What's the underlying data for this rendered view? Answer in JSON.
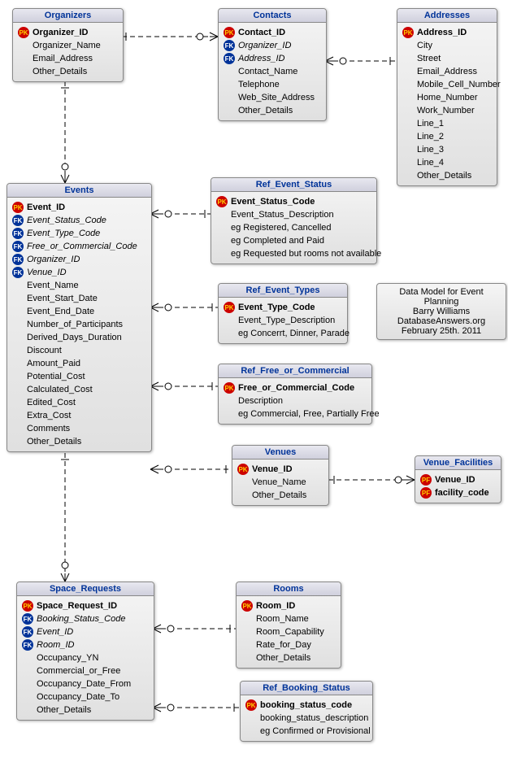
{
  "info": {
    "line1": "Data Model for Event Planning",
    "line2": "Barry Williams",
    "line3": "DatabaseAnswers.org",
    "line4": "February 25th.  2011"
  },
  "entities": {
    "organizers": {
      "title": "Organizers",
      "rows": [
        {
          "key": "PK",
          "label": "Organizer_ID",
          "b": true
        },
        {
          "key": "",
          "label": "Organizer_Name"
        },
        {
          "key": "",
          "label": "Email_Address"
        },
        {
          "key": "",
          "label": "Other_Details"
        }
      ]
    },
    "contacts": {
      "title": "Contacts",
      "rows": [
        {
          "key": "PK",
          "label": "Contact_ID",
          "b": true
        },
        {
          "key": "FK",
          "label": "Organizer_ID",
          "i": true
        },
        {
          "key": "FK",
          "label": "Address_ID",
          "i": true
        },
        {
          "key": "",
          "label": "Contact_Name"
        },
        {
          "key": "",
          "label": "Telephone"
        },
        {
          "key": "",
          "label": "Web_Site_Address"
        },
        {
          "key": "",
          "label": "Other_Details"
        }
      ]
    },
    "addresses": {
      "title": "Addresses",
      "rows": [
        {
          "key": "PK",
          "label": "Address_ID",
          "b": true
        },
        {
          "key": "",
          "label": "City"
        },
        {
          "key": "",
          "label": "Street"
        },
        {
          "key": "",
          "label": "Email_Address"
        },
        {
          "key": "",
          "label": "Mobile_Cell_Number"
        },
        {
          "key": "",
          "label": "Home_Number"
        },
        {
          "key": "",
          "label": "Work_Number"
        },
        {
          "key": "",
          "label": "Line_1"
        },
        {
          "key": "",
          "label": "Line_2"
        },
        {
          "key": "",
          "label": "Line_3"
        },
        {
          "key": "",
          "label": "Line_4"
        },
        {
          "key": "",
          "label": "Other_Details"
        }
      ]
    },
    "events": {
      "title": "Events",
      "rows": [
        {
          "key": "PK",
          "label": "Event_ID",
          "b": true
        },
        {
          "key": "FK",
          "label": "Event_Status_Code",
          "i": true
        },
        {
          "key": "FK",
          "label": "Event_Type_Code",
          "i": true
        },
        {
          "key": "FK",
          "label": "Free_or_Commercial_Code",
          "i": true
        },
        {
          "key": "FK",
          "label": "Organizer_ID",
          "i": true
        },
        {
          "key": "FK",
          "label": "Venue_ID",
          "i": true
        },
        {
          "key": "",
          "label": "Event_Name"
        },
        {
          "key": "",
          "label": "Event_Start_Date"
        },
        {
          "key": "",
          "label": "Event_End_Date"
        },
        {
          "key": "",
          "label": "Number_of_Participants"
        },
        {
          "key": "",
          "label": "Derived_Days_Duration"
        },
        {
          "key": "",
          "label": "Discount"
        },
        {
          "key": "",
          "label": "Amount_Paid"
        },
        {
          "key": "",
          "label": "Potential_Cost"
        },
        {
          "key": "",
          "label": "Calculated_Cost"
        },
        {
          "key": "",
          "label": "Edited_Cost"
        },
        {
          "key": "",
          "label": "Extra_Cost"
        },
        {
          "key": "",
          "label": "Comments"
        },
        {
          "key": "",
          "label": "Other_Details"
        }
      ]
    },
    "ref_event_status": {
      "title": "Ref_Event_Status",
      "rows": [
        {
          "key": "PK",
          "label": "Event_Status_Code",
          "b": true
        },
        {
          "key": "",
          "label": "Event_Status_Description"
        },
        {
          "key": "",
          "label": "eg Registered, Cancelled"
        },
        {
          "key": "",
          "label": "eg Completed and Paid"
        },
        {
          "key": "",
          "label": "eg Requested but rooms not available"
        }
      ]
    },
    "ref_event_types": {
      "title": "Ref_Event_Types",
      "rows": [
        {
          "key": "PK",
          "label": "Event_Type_Code",
          "b": true
        },
        {
          "key": "",
          "label": "Event_Type_Description"
        },
        {
          "key": "",
          "label": "eg Concerrt, Dinner, Parade"
        }
      ]
    },
    "ref_free_or_commercial": {
      "title": "Ref_Free_or_Commercial",
      "rows": [
        {
          "key": "PK",
          "label": "Free_or_Commercial_Code",
          "b": true
        },
        {
          "key": "",
          "label": "Description"
        },
        {
          "key": "",
          "label": "eg Commercial, Free, Partially Free"
        }
      ]
    },
    "venues": {
      "title": "Venues",
      "rows": [
        {
          "key": "PK",
          "label": "Venue_ID",
          "b": true
        },
        {
          "key": "",
          "label": "Venue_Name"
        },
        {
          "key": "",
          "label": "Other_Details"
        }
      ]
    },
    "venue_facilities": {
      "title": "Venue_Facilities",
      "rows": [
        {
          "key": "PF",
          "label": "Venue_ID",
          "b": true
        },
        {
          "key": "PF",
          "label": "facility_code",
          "b": true
        }
      ]
    },
    "space_requests": {
      "title": "Space_Requests",
      "rows": [
        {
          "key": "PK",
          "label": "Space_Request_ID",
          "b": true
        },
        {
          "key": "FK",
          "label": "Booking_Status_Code",
          "i": true
        },
        {
          "key": "FK",
          "label": "Event_ID",
          "i": true
        },
        {
          "key": "FK",
          "label": "Room_ID",
          "i": true
        },
        {
          "key": "",
          "label": "Occupancy_YN"
        },
        {
          "key": "",
          "label": "Commercial_or_Free"
        },
        {
          "key": "",
          "label": "Occupancy_Date_From"
        },
        {
          "key": "",
          "label": "Occupancy_Date_To"
        },
        {
          "key": "",
          "label": "Other_Details"
        }
      ]
    },
    "rooms": {
      "title": "Rooms",
      "rows": [
        {
          "key": "PK",
          "label": "Room_ID",
          "b": true
        },
        {
          "key": "",
          "label": "Room_Name"
        },
        {
          "key": "",
          "label": "Room_Capability"
        },
        {
          "key": "",
          "label": "Rate_for_Day"
        },
        {
          "key": "",
          "label": "Other_Details"
        }
      ]
    },
    "ref_booking_status": {
      "title": "Ref_Booking_Status",
      "rows": [
        {
          "key": "PK",
          "label": "booking_status_code",
          "b": true
        },
        {
          "key": "",
          "label": "booking_status_description"
        },
        {
          "key": "",
          "label": "eg Confirmed or Provisional"
        }
      ]
    }
  }
}
